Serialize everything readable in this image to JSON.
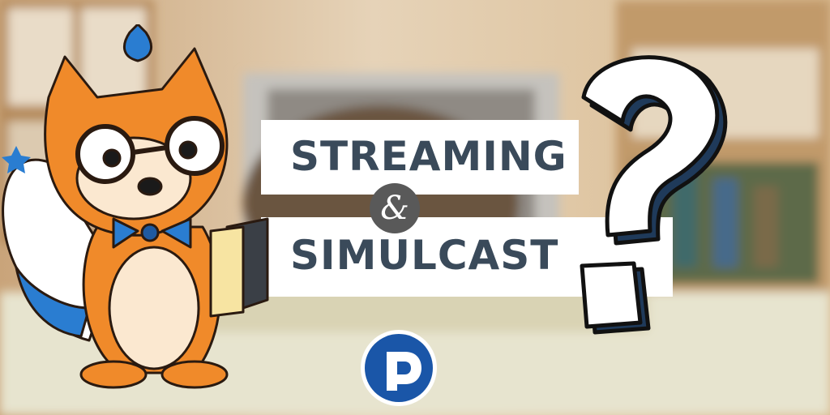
{
  "banner": {
    "title_line1": "STREAMING",
    "ampersand": "&",
    "title_line2": "SIMULCAST"
  },
  "logo": {
    "letter": "P",
    "color": "#1a56a8"
  },
  "colors": {
    "title": "#3a4a5a",
    "mascot_orange": "#f08a2a",
    "mascot_blue": "#2a7dd1",
    "question_mark_shade": "#1f3a5a"
  },
  "icons": [
    "raccoon-mascot-illustration",
    "question-mark-illustration",
    "p-logo-icon"
  ]
}
